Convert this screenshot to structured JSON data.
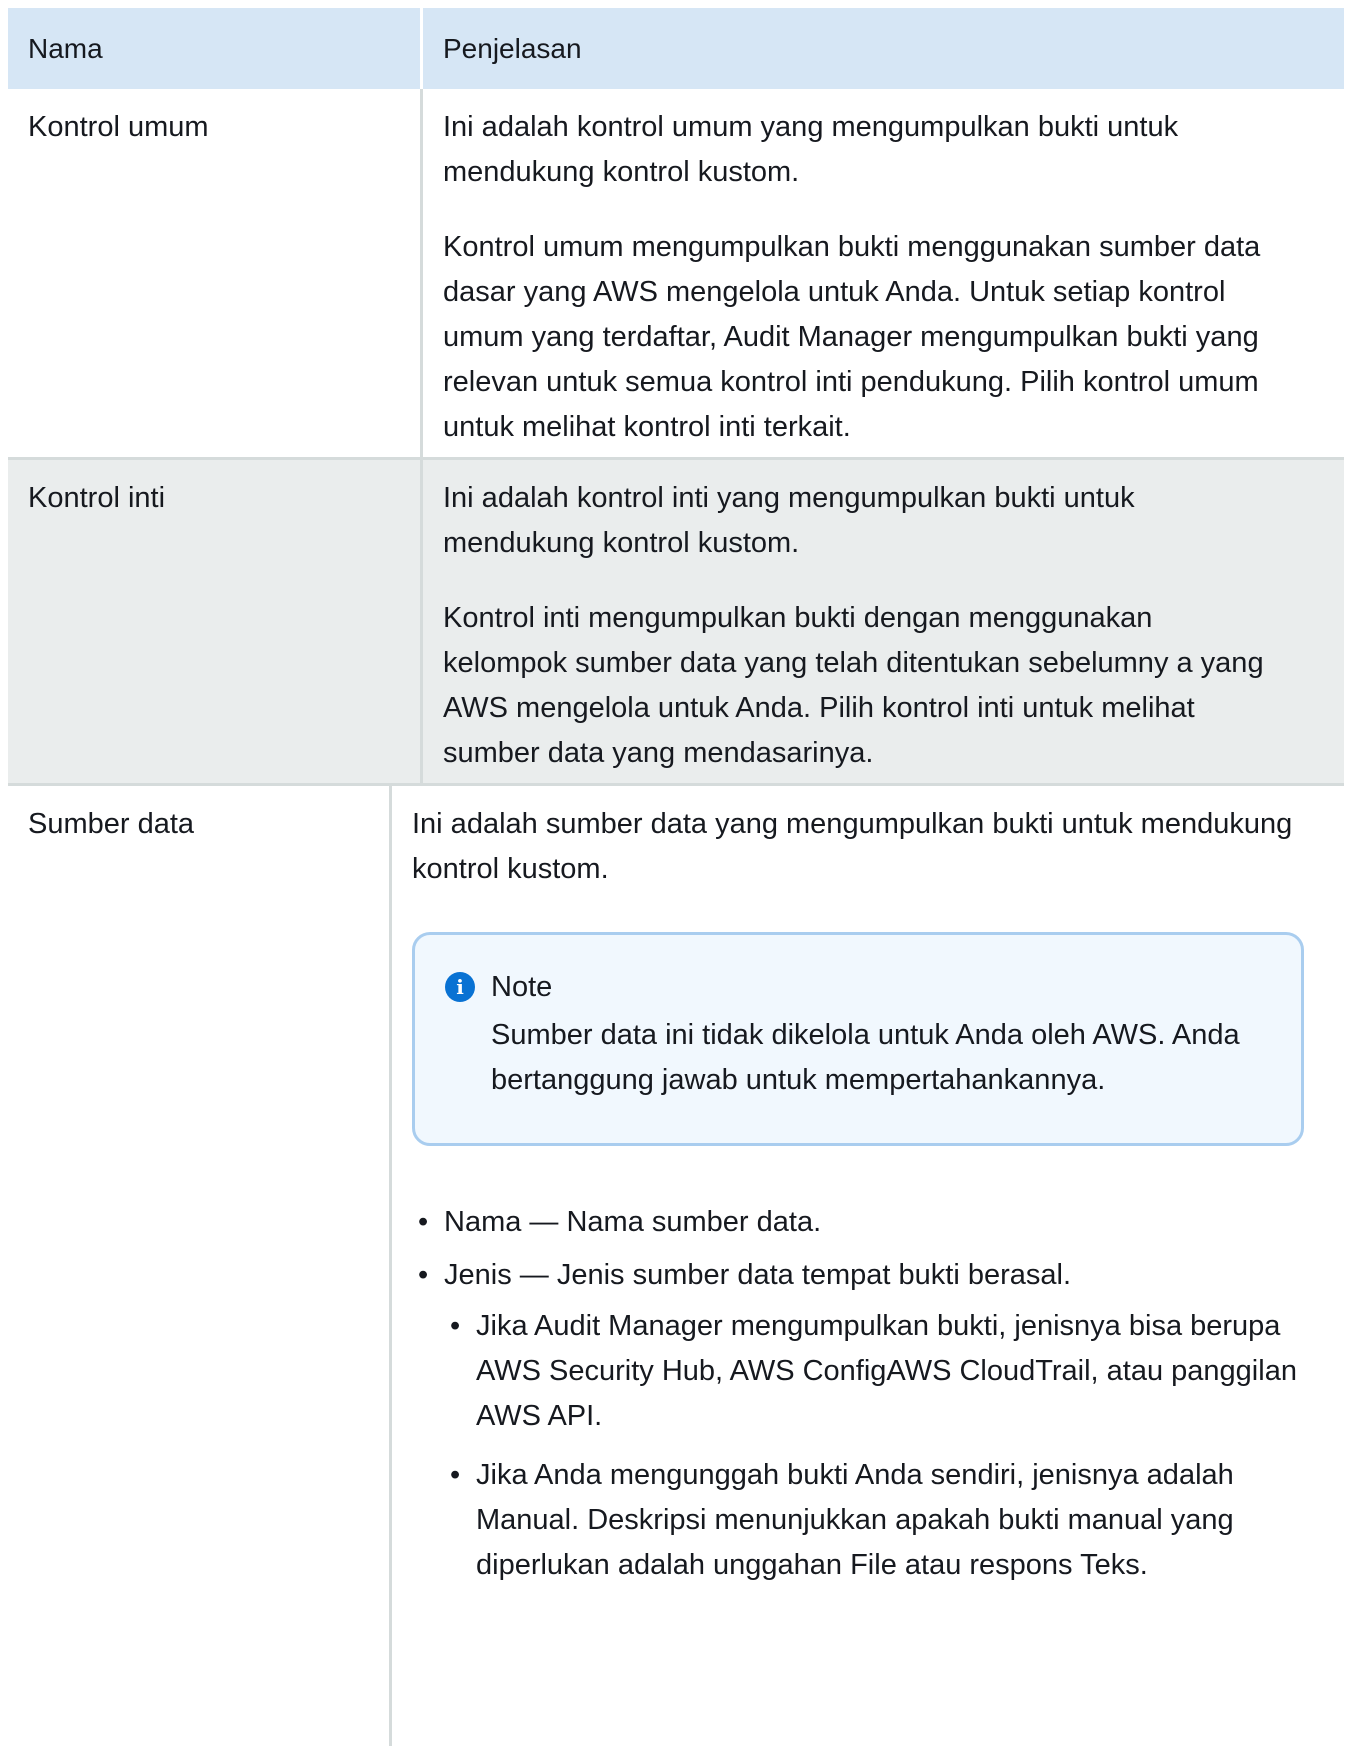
{
  "table": {
    "headers": {
      "name": "Nama",
      "description": "Penjelasan"
    },
    "rows": [
      {
        "name": "Kontrol umum",
        "paragraphs": [
          "Ini adalah kontrol umum yang mengumpulkan bukti untuk mendukung kontrol kustom.",
          "Kontrol umum mengumpulkan bukti menggunakan sumber data dasar yang AWS mengelola untuk Anda. Untuk setiap kontrol umum yang terdaftar, Audit Manager mengumpulkan bukti yang relevan untuk semua kontrol inti pendukung. Pilih kontrol umum untuk melihat kontrol inti terkait."
        ]
      },
      {
        "name": "Kontrol inti",
        "paragraphs": [
          "Ini adalah kontrol inti yang mengumpulkan bukti untuk mendukung kontrol kustom.",
          "Kontrol inti mengumpulkan bukti dengan menggunakan kelompok sumber data yang telah ditentukan sebelumny a yang AWS mengelola untuk Anda. Pilih kontrol inti untuk melihat sumber data yang mendasarinya."
        ]
      },
      {
        "name": "Sumber data",
        "paragraphs": [
          "Ini adalah sumber data yang mengumpulkan bukti untuk mendukung kontrol kustom."
        ],
        "note": {
          "title": "Note",
          "text": "Sumber data ini tidak dikelola untuk Anda oleh AWS. Anda bertanggung jawab untuk mempertahankannya."
        },
        "bullets": [
          "Nama — Nama sumber data.",
          "Jenis — Jenis sumber data tempat bukti berasal."
        ],
        "sub_bullets": [
          "Jika Audit Manager mengumpulkan bukti, jenisnya bisa berupa AWS Security Hub, AWS ConfigAWS CloudTrail, atau panggilan AWS API.",
          "Jika Anda mengunggah bukti Anda sendiri, jenisnya adalah Manual. Deskripsi menunjukkan apakah bukti manual yang diperlukan adalah unggahan File atau respons Teks."
        ]
      }
    ]
  }
}
